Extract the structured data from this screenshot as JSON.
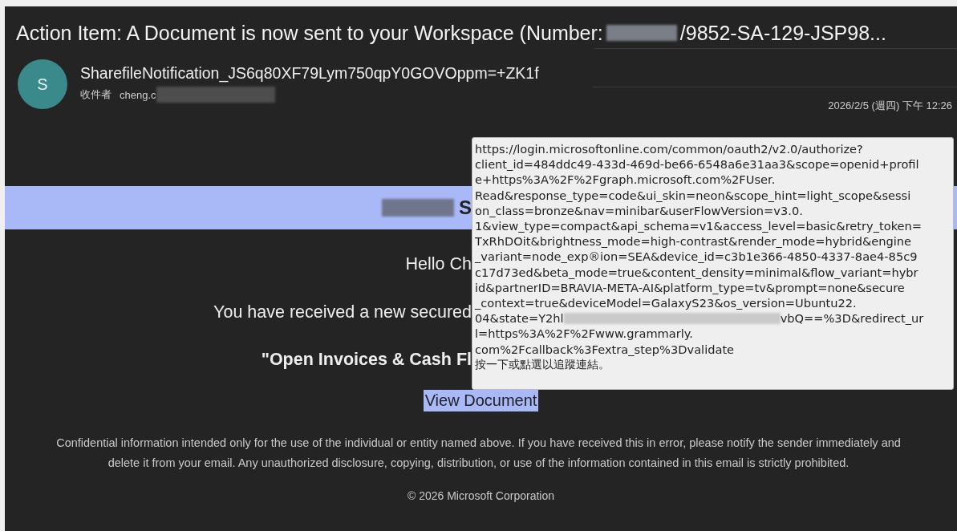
{
  "email": {
    "subject_start": "Action Item: A Document is now sent to your Workspace (Number:",
    "subject_redacted": true,
    "subject_end": "/9852-SA-129-JSP98...",
    "avatar_letter": "S",
    "sender": "SharefileNotification_JS6q80XF79Lym750qpY0GOVOppm=+ZK1f",
    "recipient_label": "收件者",
    "recipient": "cheng.c",
    "recipient_redacted": true,
    "date": "2026/2/5 (週四) 下午 12:26"
  },
  "body": {
    "banner_redacted": true,
    "banner_text": "S",
    "greeting": "Hello Ch",
    "message": "You have received a new secured",
    "document_title": "\"Open Invoices & Cash Fl",
    "link": "View Document",
    "disclaimer": "Confidential information intended only for the use of the individual or entity named above. If you have received this in error, please notify the sender immediately and delete it from your email. Any unauthorized disclosure, copying, distribution, or use of the information contained in this email is strictly prohibited.",
    "copyright": "© 2026 Microsoft Corporation"
  },
  "tooltip": {
    "lines": [
      {
        "text": "https://login.microsoftonline.com/common/oauth2/v2.0/authorize?"
      },
      {
        "text": "client_id=484ddc49-433d-469d-be66-6548a6e31aa3&scope=openid+profil"
      },
      {
        "text": "e+https%3A%2F%2Fgraph.microsoft.com%2FUser."
      },
      {
        "text": "Read&response_type=code&ui_skin=neon&scope_hint=light_scope&sessi"
      },
      {
        "text": "on_class=bronze&nav=minibar&userFlowVersion=v3.0."
      },
      {
        "text": "1&view_type=compact&api_schema=v1&access_level=basic&retry_token="
      },
      {
        "text": "TxRhDOit&brightness_mode=high-contrast&render_mode=hybrid&engine"
      },
      {
        "text": "_variant=node_exp®ion=SEA&device_id=c3b1e366-4850-4337-8ae4-85c9"
      },
      {
        "text": "c17d73ed&beta_mode=true&content_density=minimal&flow_variant=hybr"
      },
      {
        "text": "id&partnerID=BRAVIA-META-AI&platform_type=tv&prompt=none&secure"
      },
      {
        "text": "_context=true&deviceModel=GalaxyS23&os_version=Ubuntu22."
      },
      {
        "text": "04&state=Y2hl",
        "redacted": true,
        "text_after": "vbQ==%3D&redirect_ur"
      },
      {
        "text": "l=https%3A%2F%2Fwww.grammarly."
      },
      {
        "text": "com%2Fcallback%3Fextra_step%3Dvalidate"
      }
    ],
    "hint": "按一下或點選以追蹤連結。"
  }
}
